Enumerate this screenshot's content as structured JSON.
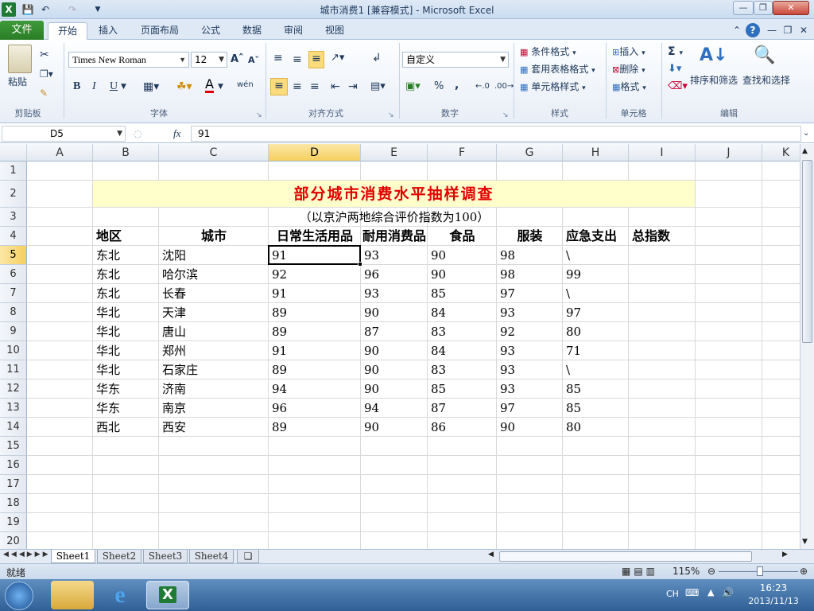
{
  "window": {
    "title": "城市消费1  [兼容模式] - Microsoft Excel",
    "app_icon": "excel-icon"
  },
  "tabs": {
    "file": "文件",
    "items": [
      "开始",
      "插入",
      "页面布局",
      "公式",
      "数据",
      "审阅",
      "视图"
    ],
    "active": "开始"
  },
  "ribbon": {
    "clipboard": {
      "paste": "粘贴",
      "label": "剪贴板"
    },
    "font": {
      "name": "Times New Roman",
      "size": "12",
      "bold": "B",
      "italic": "I",
      "underline": "U",
      "label": "字体",
      "wen": "wén"
    },
    "alignment": {
      "label": "对齐方式"
    },
    "number": {
      "format": "自定义",
      "percent": "%",
      "comma": ",",
      "label": "数字"
    },
    "styles": {
      "conditional": "条件格式",
      "table": "套用表格格式",
      "cell": "单元格样式",
      "label": "样式"
    },
    "cells": {
      "insert": "插入",
      "delete": "删除",
      "format": "格式",
      "label": "单元格"
    },
    "editing": {
      "sort": "排序和筛选",
      "find": "查找和选择",
      "label": "编辑",
      "sigma": "Σ"
    }
  },
  "formula_bar": {
    "name_box": "D5",
    "fx": "fx",
    "value": "91"
  },
  "columns": [
    "A",
    "B",
    "C",
    "D",
    "E",
    "F",
    "G",
    "H",
    "I",
    "J",
    "K"
  ],
  "rows": [
    "1",
    "2",
    "3",
    "4",
    "5",
    "6",
    "7",
    "8",
    "9",
    "10",
    "11",
    "12",
    "13",
    "14",
    "15",
    "16",
    "17",
    "18",
    "19",
    "20"
  ],
  "sheet": {
    "title": "部分城市消费水平抽样调查",
    "subtitle": "（以京沪两地综合评价指数为100）",
    "headers": [
      "地区",
      "城市",
      "日常生活用品",
      "耐用消费品",
      "食品",
      "服装",
      "应急支出",
      "总指数"
    ],
    "data": [
      [
        "东北",
        "沈阳",
        "91",
        "93",
        "90",
        "98",
        "\\",
        ""
      ],
      [
        "东北",
        "哈尔滨",
        "92",
        "96",
        "90",
        "98",
        "99",
        ""
      ],
      [
        "东北",
        "长春",
        "91",
        "93",
        "85",
        "97",
        "\\",
        ""
      ],
      [
        "华北",
        "天津",
        "89",
        "90",
        "84",
        "93",
        "97",
        ""
      ],
      [
        "华北",
        "唐山",
        "89",
        "87",
        "83",
        "92",
        "80",
        ""
      ],
      [
        "华北",
        "郑州",
        "91",
        "90",
        "84",
        "93",
        "71",
        ""
      ],
      [
        "华北",
        "石家庄",
        "89",
        "90",
        "83",
        "93",
        "\\",
        ""
      ],
      [
        "华东",
        "济南",
        "94",
        "90",
        "85",
        "93",
        "85",
        ""
      ],
      [
        "华东",
        "南京",
        "96",
        "94",
        "87",
        "97",
        "85",
        ""
      ],
      [
        "西北",
        "西安",
        "89",
        "90",
        "86",
        "90",
        "80",
        ""
      ]
    ]
  },
  "sheet_tabs": [
    "Sheet1",
    "Sheet2",
    "Sheet3",
    "Sheet4"
  ],
  "status": {
    "ready": "就绪",
    "zoom": "115%"
  },
  "taskbar": {
    "ime": "CH",
    "time": "16:23",
    "date": "2013/11/13"
  },
  "colors": {
    "title_red": "#e00000",
    "title_fill": "#ffffcc",
    "active_tab_green": "#2a7d26"
  }
}
